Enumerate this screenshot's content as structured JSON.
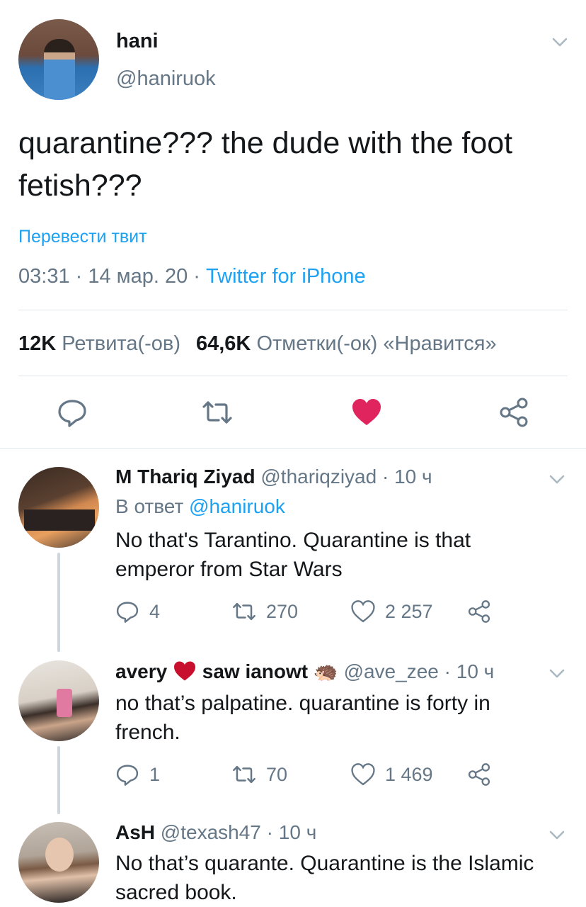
{
  "tweet": {
    "name": "hani",
    "handle": "@haniruok",
    "text": "quarantine??? the dude with the foot fetish???",
    "translate": "Перевести твит",
    "time": "03:31",
    "date": "14 мар. 20",
    "sep": " · ",
    "source": "Twitter for iPhone",
    "retweets_count": "12K",
    "retweets_label": "Ретвита(-ов)",
    "likes_count": "64,6K",
    "likes_label": "Отметки(-ок) «Нравится»",
    "liked": true,
    "colors": {
      "like": "#e0245e",
      "accent": "#1da1f2",
      "muted": "#657786"
    }
  },
  "replies": [
    {
      "name": "M Thariq Ziyad",
      "handle": "@thariqziyad",
      "time": "10 ч",
      "reply_prefix": "В ответ",
      "reply_to": "@haniruok",
      "text": "No that's Tarantino. Quarantine is that emperor from Star Wars",
      "comments": "4",
      "retweets": "270",
      "likes": "2 257"
    },
    {
      "name_part1": "avery",
      "name_part2": "saw ianowt",
      "emoji": "🦔",
      "handle": "@ave_zee",
      "time": "10 ч",
      "text": "no that’s palpatine. quarantine is forty in french.",
      "comments": "1",
      "retweets": "70",
      "likes": "1 469"
    },
    {
      "name": "AsH",
      "handle": "@texash47",
      "time": "10 ч",
      "text": "No that’s quarante. Quarantine is the Islamic sacred book."
    }
  ]
}
